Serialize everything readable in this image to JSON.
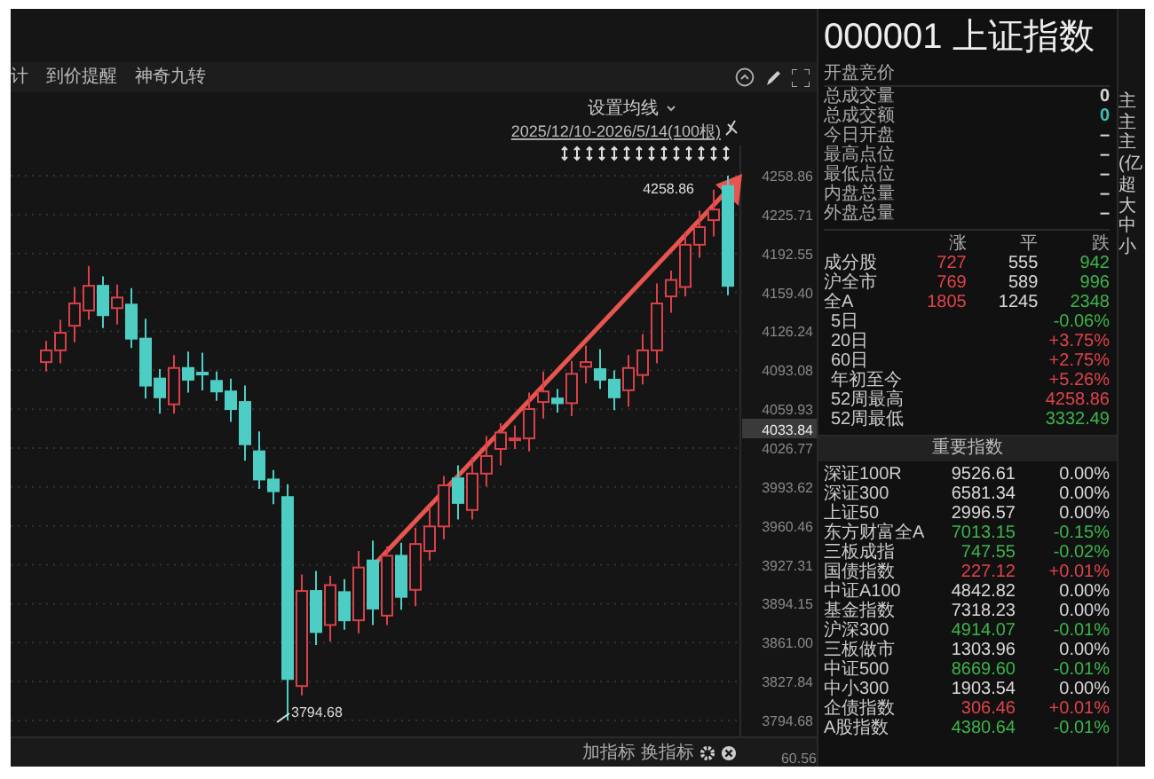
{
  "toolbar": {
    "links": [
      "计",
      "到价提醒",
      "神奇九转"
    ]
  },
  "chart": {
    "ma_setting": "设置均线",
    "range": "2025/12/10-2026/5/14(100根)",
    "high_label": "4258.86",
    "low_label": "3794.68",
    "last_price": "4033.84",
    "chart_data": {
      "type": "candlestick",
      "grid": true,
      "ylim": [
        3794.68,
        4258.86
      ],
      "yticks": [
        {
          "value": 4258.86,
          "label": "4258.86"
        },
        {
          "value": 4225.71,
          "label": "4225.71"
        },
        {
          "value": 4192.55,
          "label": "4192.55"
        },
        {
          "value": 4159.4,
          "label": "4159.40"
        },
        {
          "value": 4126.24,
          "label": "4126.24"
        },
        {
          "value": 4093.08,
          "label": "4093.08"
        },
        {
          "value": 4059.93,
          "label": "4059.93"
        },
        {
          "value": 4026.77,
          "label": "4026.77"
        },
        {
          "value": 3993.62,
          "label": "3993.62"
        },
        {
          "value": 3960.46,
          "label": "3960.46"
        },
        {
          "value": 3927.31,
          "label": "3927.31"
        },
        {
          "value": 3894.15,
          "label": "3894.15"
        },
        {
          "value": 3861.0,
          "label": "3861.00"
        },
        {
          "value": 3827.84,
          "label": "3827.84"
        },
        {
          "value": 3794.68,
          "label": "3794.68"
        }
      ],
      "ohlc": [
        [
          4100,
          4118,
          4092,
          4110
        ],
        [
          4110,
          4136,
          4099,
          4125
        ],
        [
          4131,
          4164,
          4117,
          4150
        ],
        [
          4144,
          4182,
          4136,
          4165
        ],
        [
          4165,
          4173,
          4129,
          4140
        ],
        [
          4146,
          4166,
          4132,
          4155
        ],
        [
          4149,
          4163,
          4112,
          4120
        ],
        [
          4120,
          4137,
          4069,
          4080
        ],
        [
          4086,
          4094,
          4056,
          4070
        ],
        [
          4064,
          4106,
          4056,
          4095
        ],
        [
          4095,
          4109,
          4074,
          4085
        ],
        [
          4091,
          4108,
          4076,
          4090
        ],
        [
          4084,
          4092,
          4067,
          4075
        ],
        [
          4075,
          4086,
          4049,
          4060
        ],
        [
          4066,
          4080,
          4016,
          4030
        ],
        [
          4024,
          4041,
          3992,
          4000
        ],
        [
          4000,
          4008,
          3979,
          3990
        ],
        [
          3985,
          3996,
          3794.68,
          3830
        ],
        [
          3824,
          3919,
          3816,
          3905
        ],
        [
          3905,
          3922,
          3859,
          3870
        ],
        [
          3876,
          3918,
          3862,
          3910
        ],
        [
          3904,
          3915,
          3872,
          3880
        ],
        [
          3880,
          3939,
          3869,
          3925
        ],
        [
          3931,
          3948,
          3876,
          3890
        ],
        [
          3884,
          3943,
          3876,
          3935
        ],
        [
          3935,
          3946,
          3889,
          3900
        ],
        [
          3906,
          3959,
          3892,
          3945
        ],
        [
          3939,
          3977,
          3931,
          3960
        ],
        [
          3960,
          4003,
          3949,
          3995
        ],
        [
          4001,
          4012,
          3966,
          3980
        ],
        [
          3974,
          4019,
          3966,
          4005
        ],
        [
          4005,
          4037,
          3994,
          4020
        ],
        [
          4026,
          4048,
          4012,
          4040
        ],
        [
          4034,
          4046,
          4026,
          4035
        ],
        [
          4035,
          4074,
          4024,
          4060
        ],
        [
          4066,
          4092,
          4052,
          4075
        ],
        [
          4069,
          4077,
          4057,
          4065
        ],
        [
          4065,
          4101,
          4054,
          4090
        ],
        [
          4096,
          4114,
          4082,
          4100
        ],
        [
          4094,
          4111,
          4077,
          4085
        ],
        [
          4085,
          4093,
          4059,
          4070
        ],
        [
          4076,
          4106,
          4062,
          4095
        ],
        [
          4089,
          4124,
          4081,
          4110
        ],
        [
          4110,
          4167,
          4099,
          4150
        ],
        [
          4156,
          4178,
          4142,
          4170
        ],
        [
          4164,
          4211,
          4156,
          4200
        ],
        [
          4200,
          4229,
          4189,
          4215
        ],
        [
          4221,
          4247,
          4207,
          4230
        ],
        [
          4250,
          4258.86,
          4157,
          4165
        ]
      ]
    },
    "sub_label": "60.56"
  },
  "chart_footer": {
    "buttons": [
      "加指标",
      "换指标"
    ]
  },
  "quote": {
    "title": "000001 上证指数",
    "status": "开盘竞价",
    "stats": [
      {
        "label": "总成交量",
        "value": "0",
        "color": "#d8d8d8"
      },
      {
        "label": "总成交额",
        "value": "0",
        "color": "#3fbfb8"
      },
      {
        "label": "今日开盘",
        "value": "–",
        "color": "#d8d8d8"
      },
      {
        "label": "最高点位",
        "value": "–",
        "color": "#d8d8d8"
      },
      {
        "label": "最低点位",
        "value": "–",
        "color": "#d8d8d8"
      },
      {
        "label": "内盘总量",
        "value": "–",
        "color": "#d8d8d8"
      },
      {
        "label": "外盘总量",
        "value": "–",
        "color": "#d8d8d8"
      }
    ],
    "breadth": {
      "columns": [
        {
          "label": "涨",
          "color": "#e0424b"
        },
        {
          "label": "平",
          "color": "#d8d8d8"
        },
        {
          "label": "跌",
          "color": "#3cb44b"
        }
      ],
      "rows": [
        {
          "label": "成分股",
          "values": [
            "727",
            "555",
            "942"
          ]
        },
        {
          "label": "沪全市",
          "values": [
            "769",
            "589",
            "996"
          ]
        },
        {
          "label": "全A",
          "values": [
            "1805",
            "1245",
            "2348"
          ]
        }
      ]
    },
    "returns": [
      {
        "label": "5日",
        "value": "-0.06%",
        "color": "#3cb44b"
      },
      {
        "label": "20日",
        "value": "+3.75%",
        "color": "#e0424b"
      },
      {
        "label": "60日",
        "value": "+2.75%",
        "color": "#e0424b"
      },
      {
        "label": "年初至今",
        "value": "+5.26%",
        "color": "#e0424b"
      },
      {
        "label": "52周最高",
        "value": "4258.86",
        "color": "#e0424b"
      },
      {
        "label": "52周最低",
        "value": "3332.49",
        "color": "#3cb44b"
      }
    ],
    "indices": {
      "title": "重要指数",
      "rows": [
        {
          "name": "深证100R",
          "price": "9526.61",
          "change": "0.00%",
          "color": "#d8d8d8"
        },
        {
          "name": "深证300",
          "price": "6581.34",
          "change": "0.00%",
          "color": "#d8d8d8"
        },
        {
          "name": "上证50",
          "price": "2996.57",
          "change": "0.00%",
          "color": "#d8d8d8"
        },
        {
          "name": "东方财富全A",
          "price": "7013.15",
          "change": "-0.15%",
          "color": "#3cb44b"
        },
        {
          "name": "三板成指",
          "price": "747.55",
          "change": "-0.02%",
          "color": "#3cb44b"
        },
        {
          "name": "国债指数",
          "price": "227.12",
          "change": "+0.01%",
          "color": "#e0424b"
        },
        {
          "name": "中证A100",
          "price": "4842.82",
          "change": "0.00%",
          "color": "#d8d8d8"
        },
        {
          "name": "基金指数",
          "price": "7318.23",
          "change": "0.00%",
          "color": "#d8d8d8"
        },
        {
          "name": "沪深300",
          "price": "4914.07",
          "change": "-0.01%",
          "color": "#3cb44b"
        },
        {
          "name": "三板做市",
          "price": "1303.96",
          "change": "0.00%",
          "color": "#d8d8d8"
        },
        {
          "name": "中证500",
          "price": "8669.60",
          "change": "-0.01%",
          "color": "#3cb44b"
        },
        {
          "name": "中小300",
          "price": "1903.54",
          "change": "0.00%",
          "color": "#d8d8d8"
        },
        {
          "name": "企债指数",
          "price": "306.46",
          "change": "+0.01%",
          "color": "#e0424b"
        },
        {
          "name": "A股指数",
          "price": "4380.64",
          "change": "-0.01%",
          "color": "#3cb44b"
        }
      ]
    }
  },
  "side_column": [
    "主",
    "主",
    "主",
    "(亿",
    "超",
    "大",
    "中",
    "小"
  ]
}
